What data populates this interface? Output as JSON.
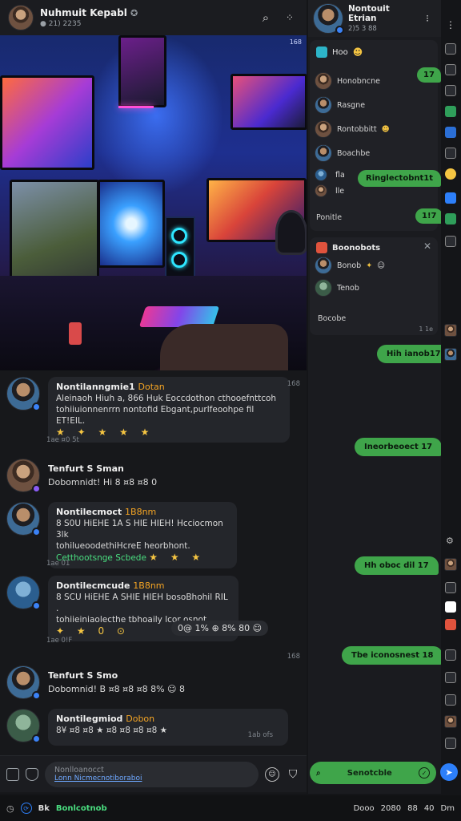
{
  "left_header": {
    "title": "Nuhmuit Kepabl",
    "subtitle": "21) 2235"
  },
  "chat": {
    "messages": [
      {
        "name": "Nontilanngmie1",
        "role": "Dotan",
        "text1": "Aleinaoh Hiuh a, 866 Huk Eoccdothon cthooefnttcoh",
        "text2": "tohiiuionnenrrn nontofid Ebgant,purlfeoohpe fil ET!EIL.",
        "emojis": "★ ✦ ★ ★ ★",
        "time": "168",
        "meta": "1ae ¤0 5t"
      },
      {
        "name": "Tenfurt S Sman",
        "text1": "Dobomnidt! Hi 8 ¤8 ¤8 0",
        "meta": ""
      },
      {
        "name": "Nontilecmoct",
        "role": "1B8nm",
        "text1": "8 S0U HiEHE 1A S HIE HIEH!  Hcciocmon 3lk",
        "text2": "tohilueoodethiHcreE heorbhont.",
        "green": "Cetthootsnge Scbede",
        "emojis": "★ ★ ★",
        "meta": "1ae 01"
      },
      {
        "name": "Dontilecmcude",
        "role": "1B8nm",
        "text1": "8 SCU HiEHE A SHIE HIEH bosoBhohil RIL .",
        "text2": "tohiieiniaolecthe tbhoaily lcor osnot",
        "emojis": "✦ ★ 0 ⊙",
        "reacts": "0@ 1% ⊕ 8% 80 ☺",
        "meta": "1ae 0!F"
      },
      {
        "name": "Tenfurt S Smo",
        "text1": "Dobomnid! B ¤8 ¤8 ¤8 8% ☺ 8",
        "time": "168"
      },
      {
        "name": "Nontilegmiod",
        "role": "Dobon",
        "text1": "8¥ ¤8 ¤8 ★ ¤8 ¤8 ¤8 ¤8 ★",
        "time": "1ab ofs"
      }
    ]
  },
  "composer": {
    "line1": "Nonlloanocct",
    "line2": "Lonn Nicmecnotiboraboi"
  },
  "right_header": {
    "title": "Nontouit Etrian",
    "subtitle": "2)5 3 88"
  },
  "right_panel1": {
    "head": "Hoo",
    "rows": [
      "Honobncne",
      "Rasgne",
      "Rontobbitt",
      "Boachbe",
      "fla",
      "lle"
    ],
    "bubble1": "17",
    "bubble2": "Ringlectobnt1t",
    "footer": "Ponitle",
    "footer_bubble": "1!7"
  },
  "right_panel2": {
    "head": "Boonobots",
    "rows": [
      "Bonob",
      "Tenob"
    ],
    "footer": "Bocobe",
    "time": "1 1e"
  },
  "out_bubbles": [
    "Hih ianob17",
    "Ineorbeoect 17",
    "Hh oboc dil 17",
    "Tbe iconosnest 18"
  ],
  "right_search": {
    "label": "Senotcble"
  },
  "statusbar": {
    "left": "Bk",
    "green": "Bonlcotnob",
    "right": [
      "Dooo",
      "2080",
      "88",
      "40",
      "Dm"
    ]
  },
  "colors": {
    "accent_green": "#3fa54a",
    "bg": "#141518",
    "bubble": "#24262b",
    "link_blue": "#2d7ff9"
  }
}
